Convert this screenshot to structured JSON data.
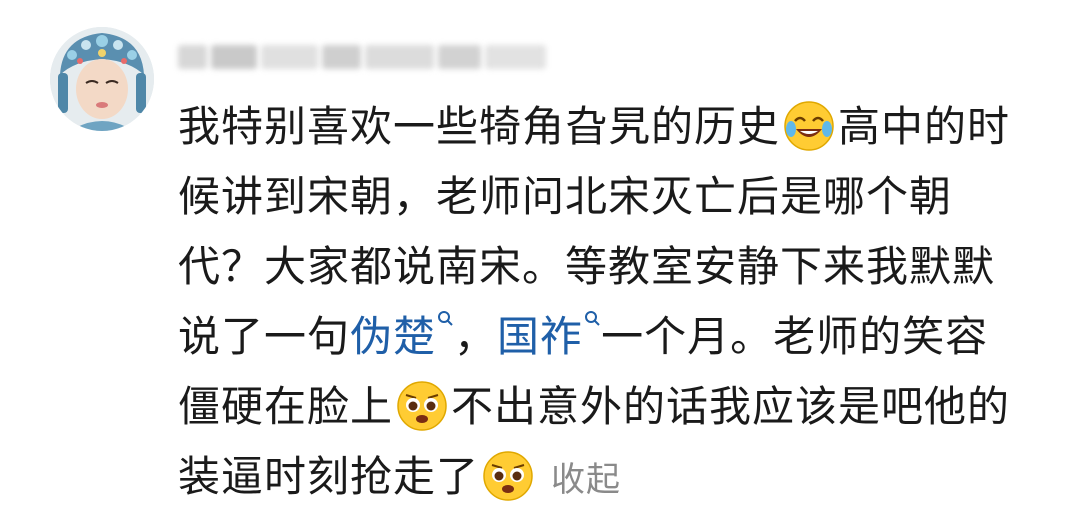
{
  "comment": {
    "lines": [
      [
        "我特别喜欢一些犄角旮旯的历史",
        "高中的时"
      ],
      [
        "候讲到宋朝，老师问北宋灭亡后是哪个朝"
      ],
      [
        "代？大家都说南宋。等教室安静下来我默默"
      ],
      [
        "说了一句",
        "伪楚",
        "，",
        "国祚",
        "一个月。老师的笑容"
      ],
      [
        "僵硬在脸上",
        "不出意外的话我应该是吧他的"
      ],
      [
        "装逼时刻抢走了"
      ]
    ],
    "collapse_label": "收起",
    "emojis": [
      "laugh-cry-emoji",
      "pleading-emoji",
      "pleading-emoji"
    ]
  },
  "colors": {
    "link": "#1f5fa8",
    "text": "#1a1a1a",
    "muted": "#8a8a8a"
  }
}
